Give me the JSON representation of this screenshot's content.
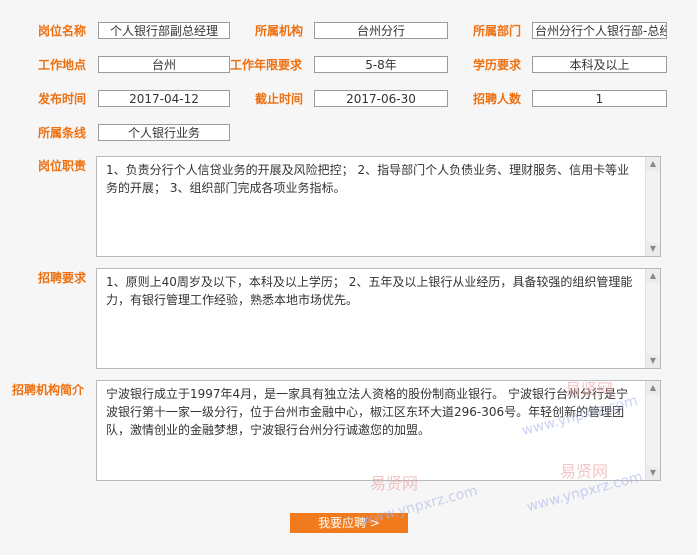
{
  "fields": {
    "position_name": {
      "label": "岗位名称",
      "value": "个人银行部副总经理"
    },
    "institution": {
      "label": "所属机构",
      "value": "台州分行"
    },
    "department": {
      "label": "所属部门",
      "value": "台州分行个人银行部-总经"
    },
    "location": {
      "label": "工作地点",
      "value": "台州"
    },
    "experience": {
      "label": "工作年限要求",
      "value": "5-8年"
    },
    "education": {
      "label": "学历要求",
      "value": "本科及以上"
    },
    "publish_date": {
      "label": "发布时间",
      "value": "2017-04-12"
    },
    "deadline": {
      "label": "截止时间",
      "value": "2017-06-30"
    },
    "headcount": {
      "label": "招聘人数",
      "value": "1"
    },
    "business_line": {
      "label": "所属条线",
      "value": "个人银行业务"
    }
  },
  "duties": {
    "label": "岗位职责",
    "text": "1、负责分行个人信贷业务的开展及风险把控； 2、指导部门个人负债业务、理财服务、信用卡等业务的开展； 3、组织部门完成各项业务指标。"
  },
  "requirements": {
    "label": "招聘要求",
    "text": "1、原则上40周岁及以下，本科及以上学历； 2、五年及以上银行从业经历，具备较强的组织管理能力，有银行管理工作经验，熟悉本地市场优先。"
  },
  "intro": {
    "label": "招聘机构简介",
    "text": "宁波银行成立于1997年4月，是一家具有独立法人资格的股份制商业银行。 宁波银行台州分行是宁波银行第十一家一级分行，位于台州市金融中心，椒江区东环大道296-306号。年轻创新的管理团队，激情创业的金融梦想，宁波银行台州分行诚邀您的加盟。"
  },
  "apply_button": "我要应聘 >",
  "watermarks": {
    "site_cn": "易贤网",
    "site_url": "www.ynpxrz.com"
  },
  "colors": {
    "accent": "#ee7010",
    "button": "#f07a1c"
  }
}
